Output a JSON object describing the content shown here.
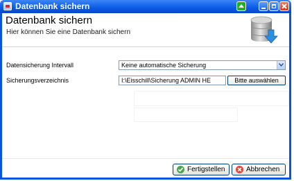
{
  "window": {
    "title": "Datenbank sichern",
    "colors": {
      "titlebar": "#0a5ae6",
      "close": "#d63a16",
      "accent_green": "#20b020"
    }
  },
  "header": {
    "title": "Datenbank sichern",
    "subtitle": "Hier können Sie eine Datenbank sichern",
    "icon": "database-backup-icon"
  },
  "form": {
    "interval_label": "Datensicherung Intervall",
    "interval_value": "Keine automatische Sicherung",
    "directory_label": "Sicherungsverzeichnis",
    "directory_value": "I:\\Eisschill\\Sicherung ADMIN HE",
    "browse_label": "Bitte auswählen"
  },
  "footer": {
    "finish_label": "Fertigstellen",
    "finish_icon": "check-circle-icon",
    "cancel_label": "Abbrechen",
    "cancel_icon": "cancel-circle-icon"
  }
}
